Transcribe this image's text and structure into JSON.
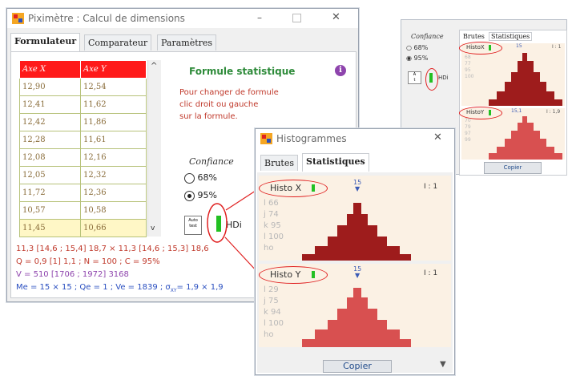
{
  "main_window": {
    "title": "Piximètre : Calcul de dimensions",
    "tabs": [
      "Formulateur",
      "Comparateur",
      "Paramètres"
    ],
    "table": {
      "headers": [
        "Axe X",
        "Axe Y"
      ],
      "rows": [
        [
          "12,90",
          "12,54"
        ],
        [
          "12,41",
          "11,62"
        ],
        [
          "12,42",
          "11,86"
        ],
        [
          "12,28",
          "11,61"
        ],
        [
          "12,08",
          "12,16"
        ],
        [
          "12,05",
          "12,32"
        ],
        [
          "11,72",
          "12,36"
        ],
        [
          "10,57",
          "10,58"
        ],
        [
          "11,45",
          "10,66"
        ]
      ]
    },
    "formula_heading": "Formule statistique",
    "formula_help": [
      "Pour changer de formule",
      "clic droit ou gauche",
      "sur la formule."
    ],
    "confidence_label": "Confiance",
    "options": [
      "68%",
      "95%"
    ],
    "auto_test_label": [
      "Auto",
      "test"
    ],
    "hdi_label": "HDi",
    "results": [
      "11,3 [14,6 ; 15,4] 18,7 × 11,3 [14,6 ; 15,3] 18,6",
      "Q = 0,9 [1] 1,1 ; N = 100 ; C = 95%",
      "V = 510 [1706 ; 1972] 3168",
      "Me = 15 × 15 ; Qe = 1 ; Ve = 1839 ; σ",
      "XY",
      "= 1,9 × 1,9"
    ]
  },
  "histo_window": {
    "title": "Histogrammes",
    "tabs": [
      "Brutes",
      "Statistiques"
    ],
    "histo_x": {
      "label": "Histo X",
      "peak": "15",
      "ratio": "I : 1",
      "stats": [
        "l 66",
        "j 74",
        "k 95",
        "l 100",
        "ho"
      ]
    },
    "histo_y": {
      "label": "Histo Y",
      "peak": "15",
      "ratio": "I : 1",
      "stats": [
        "l 29",
        "j 75",
        "k 94",
        "l 100",
        "ho"
      ]
    },
    "copy_button": "Copier"
  },
  "mini_window": {
    "confidence_label": "Confiance",
    "options": [
      "68%",
      "95%"
    ],
    "tabs": [
      "Brutes",
      "Statistiques"
    ],
    "histo_x_label": "HistoX",
    "histo_x_peak": "15",
    "histo_x_ratio": "I : 1",
    "histo_x_stats": [
      "68",
      "77",
      "95",
      "100"
    ],
    "histo_y_label": "HistoY",
    "histo_y_peak": "15,1",
    "histo_y_ratio": "I : 1,9",
    "histo_y_stats": [
      "70",
      "79",
      "97",
      "99"
    ],
    "copy_button": "Copier",
    "hdi_label": "HDi"
  },
  "colors": {
    "accent_red": "#e0101a",
    "table_header": "#ff1a1a",
    "histo_dark": "#9e1c1c",
    "histo_light": "#d85050",
    "histo_bg": "#fbf1e4",
    "green": "#22c022",
    "annotation": "#e02020"
  },
  "icons": [
    "app-icon",
    "info-icon",
    "green-indicator-icon",
    "peak-marker-icon",
    "scroll-up-icon",
    "scroll-down-icon",
    "close-icon",
    "maximize-icon",
    "minimize-icon"
  ]
}
